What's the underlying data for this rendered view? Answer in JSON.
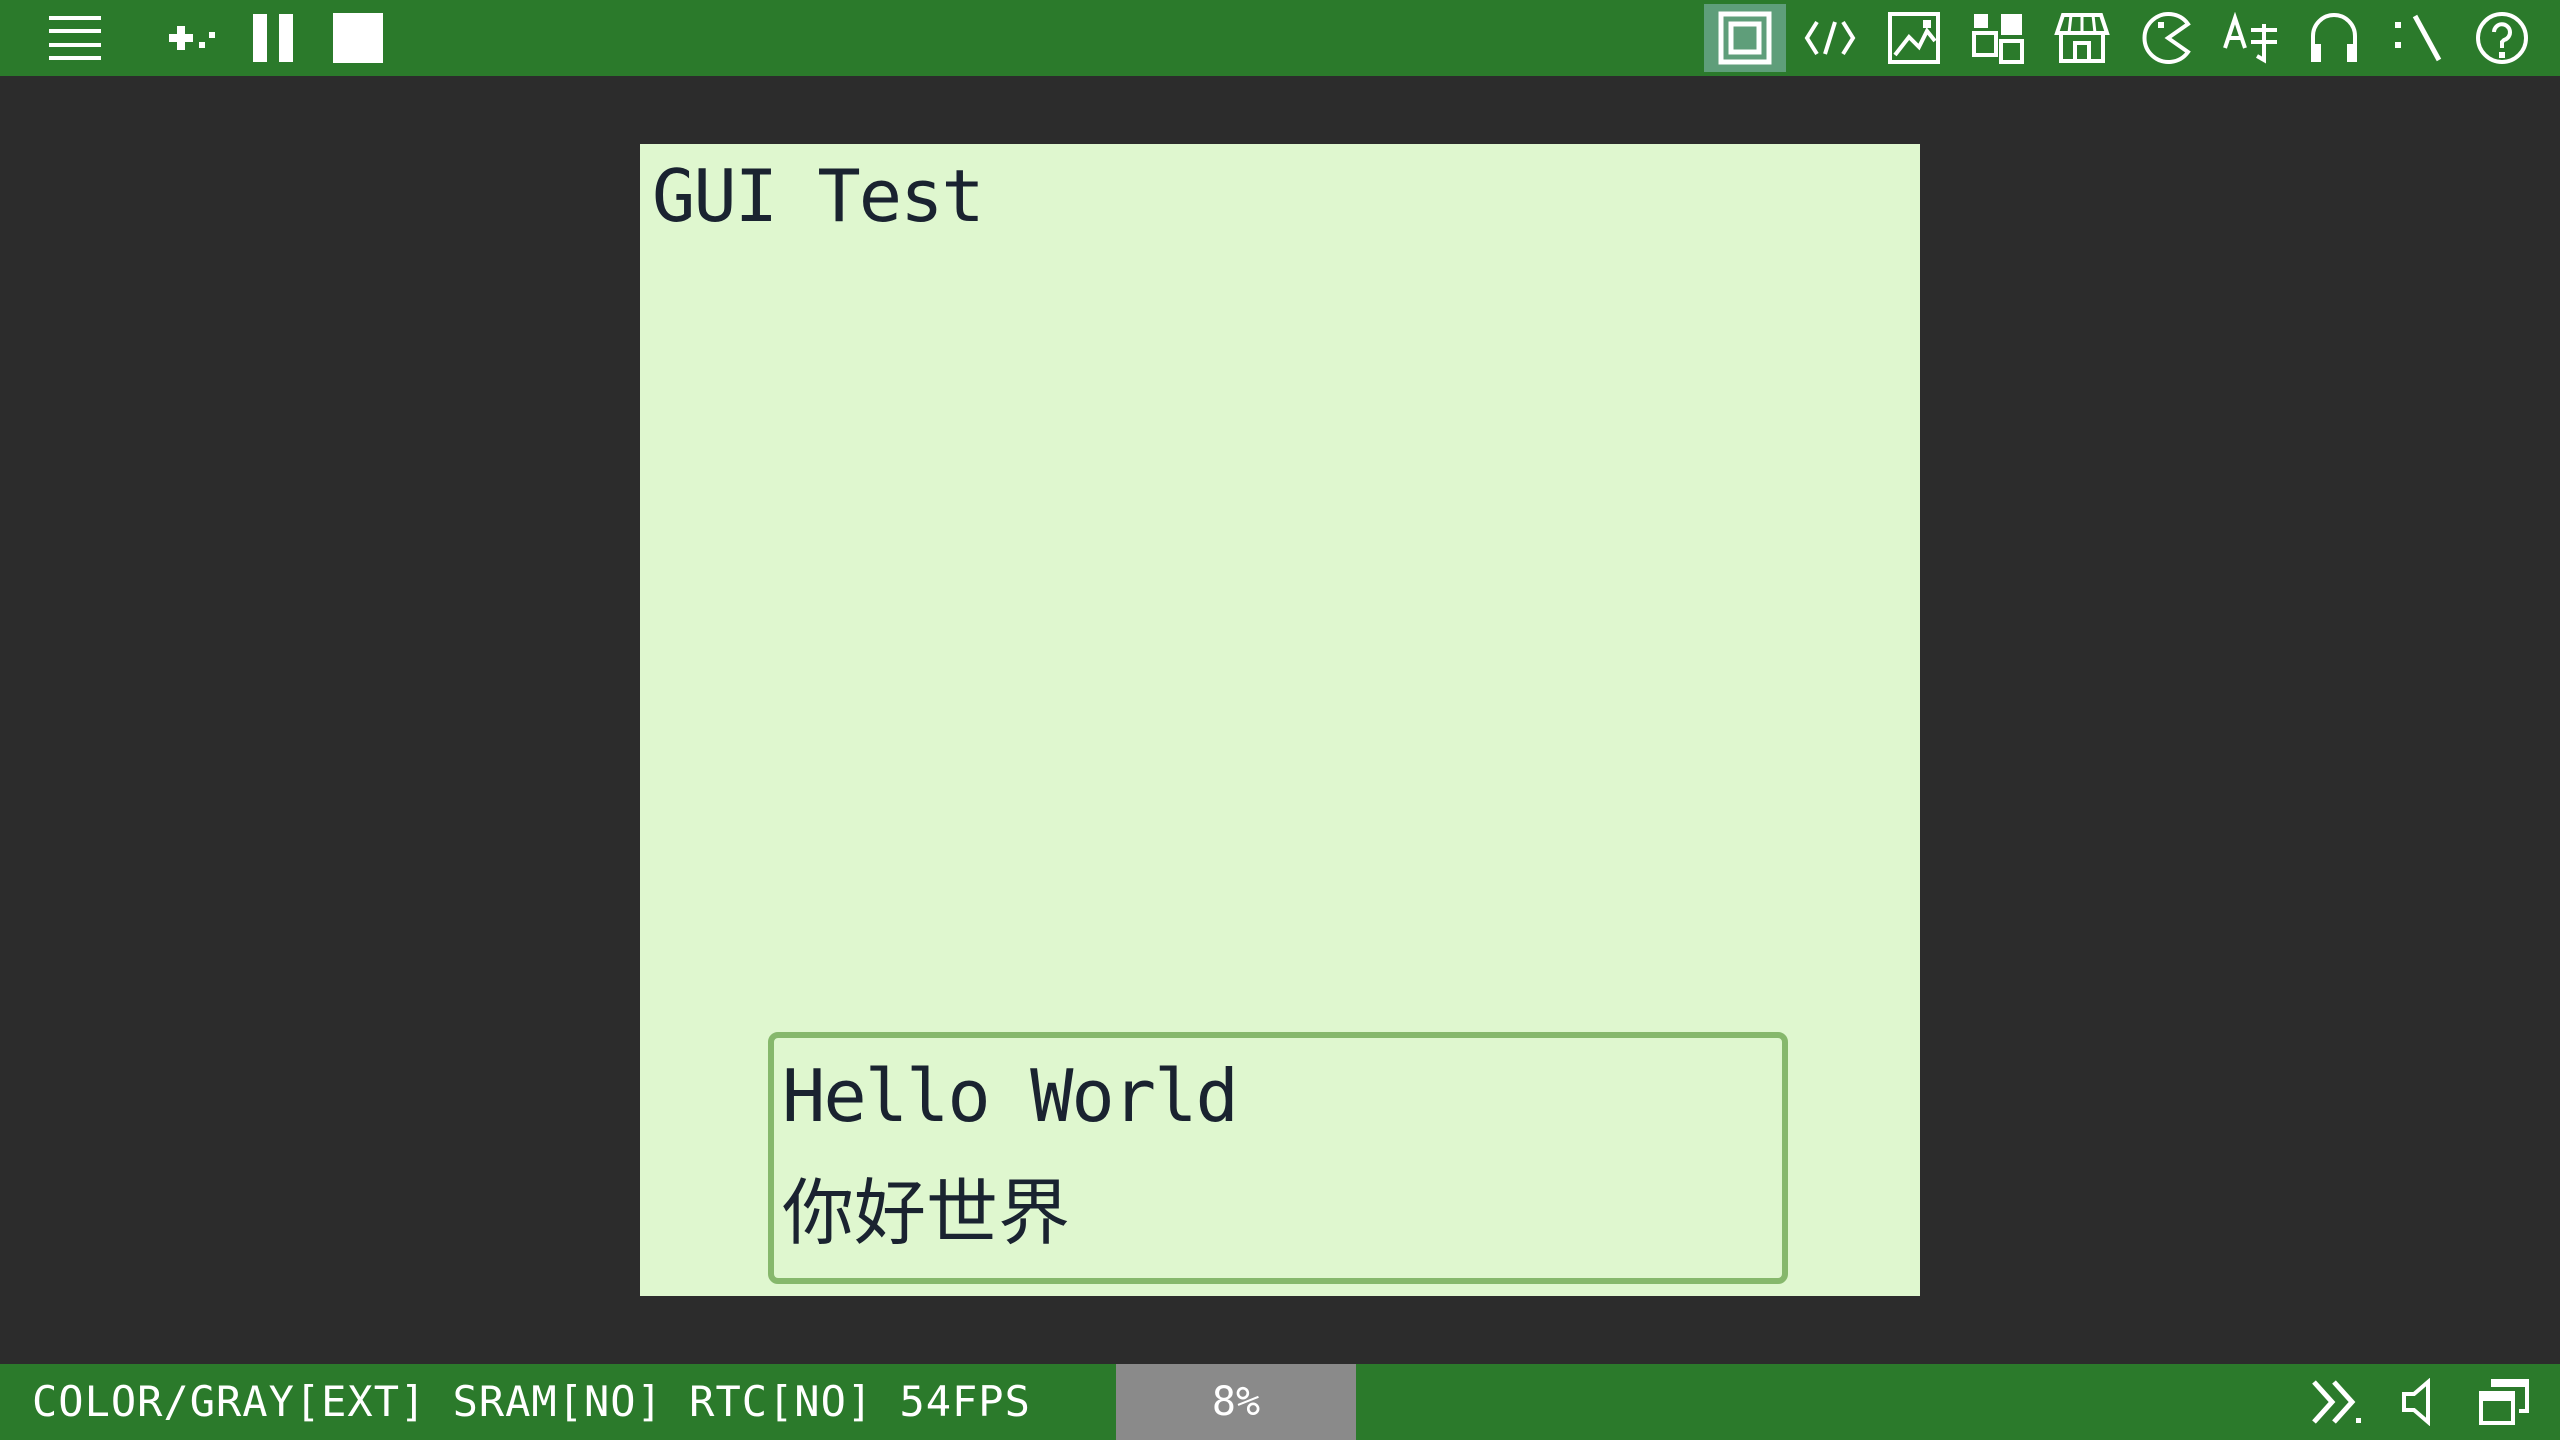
{
  "toolbar": {
    "left_icons": [
      "menu-icon",
      "gamepad-icon",
      "pause-icon",
      "stop-icon"
    ],
    "right_icons": [
      "screen-icon",
      "code-icon",
      "image-icon",
      "widgets-icon",
      "store-icon",
      "pacman-icon",
      "translate-icon",
      "headphones-icon",
      "cheat-icon",
      "help-icon"
    ],
    "active_icon": "screen-icon"
  },
  "screen": {
    "title": "GUI Test",
    "dialog": {
      "line1": "Hello World",
      "line2": "你好世界"
    }
  },
  "status": {
    "info": "COLOR/GRAY[EXT] SRAM[NO] RTC[NO] 54FPS",
    "speed": "8%",
    "right_icons": [
      "fast-forward-icon",
      "volume-icon",
      "window-icon"
    ]
  },
  "colors": {
    "bar": "#2b7a2b",
    "background": "#2c2c2c",
    "screen": "#dff7cf",
    "text": "#1a2330",
    "dialog_border": "#86b86c",
    "speed_box": "#8a8a8a",
    "active_tab": "#5f9e7a"
  }
}
